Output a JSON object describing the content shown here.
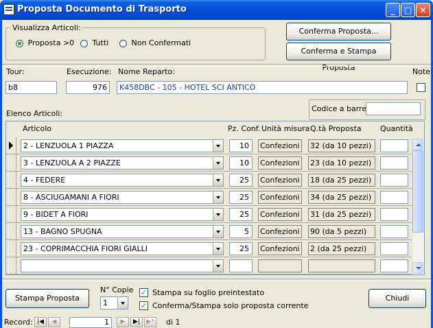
{
  "window": {
    "title": "Proposta Documento di Trasporto"
  },
  "filter": {
    "legend": "Visualizza Articoli:",
    "options": [
      {
        "label": "Proposta >0",
        "selected": true
      },
      {
        "label": "Tutti",
        "selected": false
      },
      {
        "label": "Non Confermati",
        "selected": false
      }
    ]
  },
  "actions": {
    "confirm_label": "Conferma Proposta...",
    "confirm_print_label": "Conferma e Stampa Proposta"
  },
  "header": {
    "tour_label": "Tour:",
    "tour_value": "b8",
    "exec_label": "Esecuzione:",
    "exec_value": "976",
    "reparto_label": "Nome Reparto:",
    "reparto_value": "K458DBC - 105 - HOTEL SCI ANTICO",
    "note_label": "Note"
  },
  "list": {
    "label": "Elenco Articoli:",
    "barcode_label": "Codice a barre:",
    "barcode_value": ""
  },
  "columns": {
    "articolo": "Articolo",
    "pz": "Pz. Conf.",
    "unita": "Unità misura",
    "qta": "Q.tà Proposta",
    "quantita": "Quantità"
  },
  "rows": [
    {
      "articolo": "2 - LENZUOLA 1 PIAZZA",
      "pz": "10",
      "unita": "Confezioni",
      "proposta": "32 (da 10 pezzi)",
      "quantita": ""
    },
    {
      "articolo": "3 - LENZUOLA A 2 PIAZZE",
      "pz": "10",
      "unita": "Confezioni",
      "proposta": "23 (da 10 pezzi)",
      "quantita": ""
    },
    {
      "articolo": "4 - FEDERE",
      "pz": "25",
      "unita": "Confezioni",
      "proposta": "18 (da 25 pezzi)",
      "quantita": ""
    },
    {
      "articolo": "8 - ASCIUGAMANI A FIORI",
      "pz": "25",
      "unita": "Confezioni",
      "proposta": "34 (da 25 pezzi)",
      "quantita": ""
    },
    {
      "articolo": "9 - BIDET A FIORI",
      "pz": "25",
      "unita": "Confezioni",
      "proposta": "31 (da 25 pezzi)",
      "quantita": ""
    },
    {
      "articolo": "13 - BAGNO SPUGNA",
      "pz": "5",
      "unita": "Confezioni",
      "proposta": "90 (da 5 pezzi)",
      "quantita": ""
    },
    {
      "articolo": "23 - COPRIMACCHIA FIORI GIALLI",
      "pz": "25",
      "unita": "Confezioni",
      "proposta": "2 (da 25 pezzi)",
      "quantita": ""
    },
    {
      "articolo": "",
      "pz": "",
      "unita": "",
      "proposta": "",
      "quantita": ""
    }
  ],
  "footer": {
    "print_label": "Stampa Proposta",
    "copies_label": "N° Copie",
    "copies_value": "1",
    "opt1_label": "Stampa su foglio preintestato",
    "opt1_checked": true,
    "opt2_label": "Conferma/Stampa solo proposta corrente",
    "opt2_checked": true,
    "close_label": "Chiudi"
  },
  "nav": {
    "record_label": "Record:",
    "current": "1",
    "of_label": "di 1"
  },
  "icons": {
    "first": "first-record-icon",
    "prev": "prev-record-icon",
    "next": "next-record-icon",
    "last": "last-record-icon",
    "new": "new-record-icon"
  }
}
